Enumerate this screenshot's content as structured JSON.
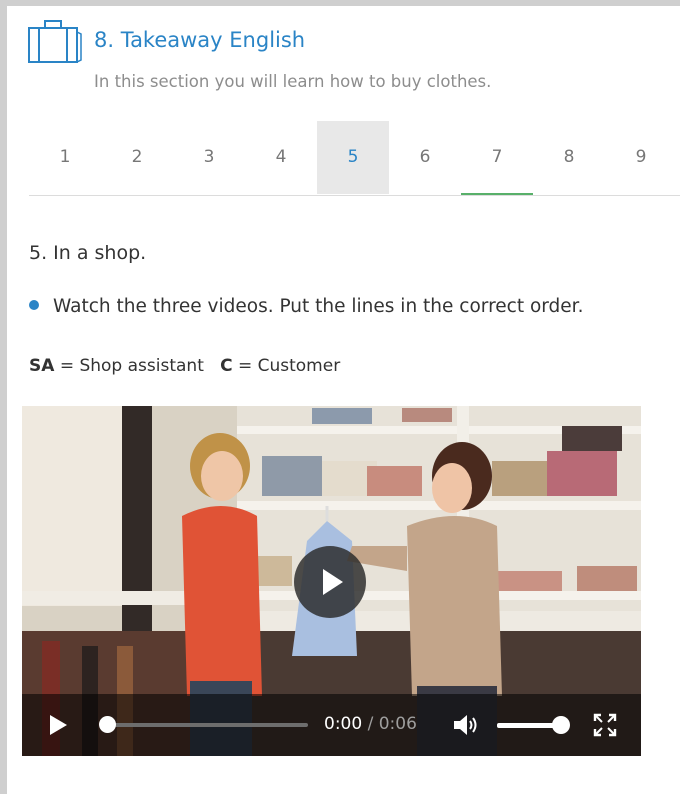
{
  "unit": {
    "icon": "suitcase-icon",
    "title": "8. Takeaway English",
    "subtitle": "In this section you will learn how to buy clothes."
  },
  "tabs": [
    {
      "label": "1"
    },
    {
      "label": "2"
    },
    {
      "label": "3"
    },
    {
      "label": "4"
    },
    {
      "label": "5",
      "active": true
    },
    {
      "label": "6"
    },
    {
      "label": "7",
      "completed": true
    },
    {
      "label": "8"
    },
    {
      "label": "9"
    }
  ],
  "content": {
    "section_title": "5. In a shop.",
    "instruction": "Watch the three videos. Put the lines in the correct order.",
    "legend": [
      {
        "abbr": "SA",
        "meaning": "= Shop assistant"
      },
      {
        "abbr": "C",
        "meaning": "= Customer"
      }
    ]
  },
  "video": {
    "current_time": "0:00",
    "separator": "/",
    "duration": "0:06",
    "progress": 0,
    "volume": 1.0,
    "icons": [
      "play-icon",
      "volume-icon",
      "fullscreen-icon"
    ]
  },
  "colors": {
    "accent": "#2a84c6",
    "tab_active_bg": "#e8e8e8",
    "tab_completed": "#58b06a"
  }
}
